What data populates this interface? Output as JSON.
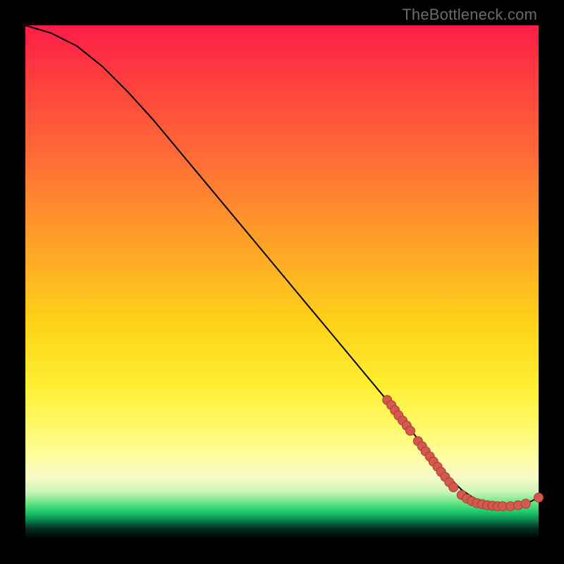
{
  "watermark": "TheBottleneck.com",
  "colors": {
    "dot_fill": "#d4584c",
    "dot_stroke": "#a63e34",
    "curve": "#000000"
  },
  "chart_data": {
    "type": "line",
    "title": "",
    "xlabel": "",
    "ylabel": "",
    "xlim": [
      0,
      100
    ],
    "ylim": [
      0,
      100
    ],
    "grid": false,
    "legend": false,
    "series": [
      {
        "name": "curve",
        "x": [
          0,
          5,
          10,
          15,
          20,
          25,
          30,
          35,
          40,
          45,
          50,
          55,
          60,
          65,
          70,
          72,
          74,
          76,
          78,
          80,
          82,
          85,
          88,
          91,
          94,
          97,
          100
        ],
        "y": [
          100,
          98.5,
          96,
          92,
          87,
          81.5,
          75.5,
          69.5,
          63.5,
          57.5,
          51.5,
          45.5,
          39.5,
          33.5,
          27.5,
          25,
          22.5,
          20,
          17.5,
          15,
          12.5,
          9.5,
          7.5,
          6.5,
          6.3,
          6.5,
          8.0
        ]
      }
    ],
    "points": [
      {
        "x": 70.5,
        "y": 27.0
      },
      {
        "x": 71.3,
        "y": 26.0
      },
      {
        "x": 72.0,
        "y": 25.0
      },
      {
        "x": 72.7,
        "y": 24.0
      },
      {
        "x": 73.5,
        "y": 23.0
      },
      {
        "x": 74.3,
        "y": 22.0
      },
      {
        "x": 75.0,
        "y": 21.0
      },
      {
        "x": 76.5,
        "y": 19.0
      },
      {
        "x": 77.3,
        "y": 18.0
      },
      {
        "x": 78.0,
        "y": 17.0
      },
      {
        "x": 78.8,
        "y": 16.0
      },
      {
        "x": 79.5,
        "y": 15.0
      },
      {
        "x": 80.3,
        "y": 14.0
      },
      {
        "x": 81.0,
        "y": 13.0
      },
      {
        "x": 81.8,
        "y": 12.0
      },
      {
        "x": 82.6,
        "y": 11.0
      },
      {
        "x": 83.4,
        "y": 10.0
      },
      {
        "x": 85.0,
        "y": 8.5
      },
      {
        "x": 86.0,
        "y": 7.8
      },
      {
        "x": 87.0,
        "y": 7.3
      },
      {
        "x": 88.0,
        "y": 6.9
      },
      {
        "x": 89.0,
        "y": 6.7
      },
      {
        "x": 90.0,
        "y": 6.5
      },
      {
        "x": 91.0,
        "y": 6.4
      },
      {
        "x": 92.0,
        "y": 6.3
      },
      {
        "x": 93.0,
        "y": 6.3
      },
      {
        "x": 94.5,
        "y": 6.3
      },
      {
        "x": 96.0,
        "y": 6.5
      },
      {
        "x": 97.5,
        "y": 6.8
      },
      {
        "x": 100.0,
        "y": 8.0
      }
    ]
  }
}
